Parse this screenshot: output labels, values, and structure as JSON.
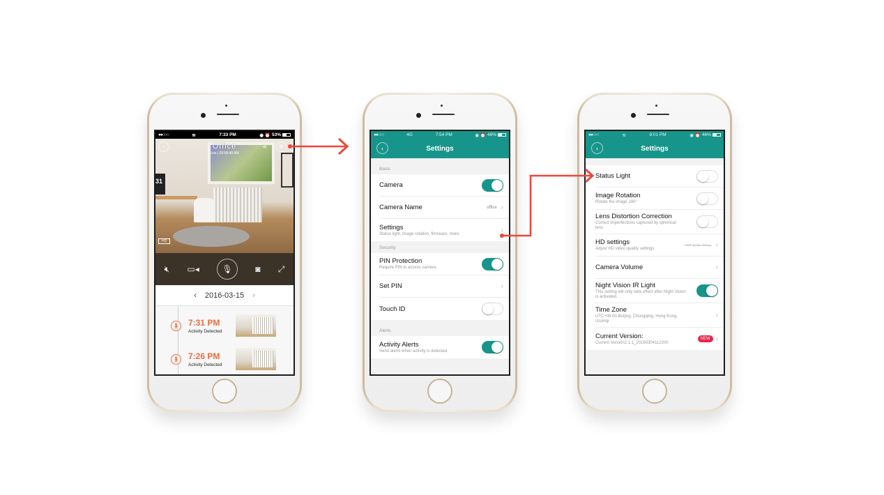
{
  "colors": {
    "teal": "#17958a",
    "accent_orange": "#f26a3d",
    "arrow_red": "#f0453a",
    "new_badge": "#e8254b"
  },
  "phone1": {
    "status": {
      "signal": "●●○○○",
      "wifi_icon": "wifi-icon",
      "time": "7:33 PM",
      "battery": "53%"
    },
    "camera": {
      "title": "Office",
      "subtitle": "Live | 02:58:40 AM",
      "quality_badge": "HD",
      "calendar_digit": "31"
    },
    "controls": [
      "mute-icon",
      "record-video-icon",
      "microphone-icon",
      "snapshot-icon",
      "fullscreen-icon"
    ],
    "date_nav": {
      "prev": "‹",
      "date": "2016-03-15",
      "next": "›"
    },
    "events": [
      {
        "time": "7:31 PM",
        "label": "Activity Detected"
      },
      {
        "time": "7:26 PM",
        "label": "Activity Detected"
      }
    ]
  },
  "phone2": {
    "status": {
      "signal": "●●○○○",
      "network": "4G",
      "time": "7:54 PM",
      "battery": "48%"
    },
    "title": "Settings",
    "sections": {
      "basic": "Basic",
      "security": "Security",
      "alerts": "Alerts"
    },
    "rows": {
      "camera": {
        "title": "Camera",
        "toggle_on": true
      },
      "camera_name": {
        "title": "Camera Name",
        "value": "office"
      },
      "settings": {
        "title": "Settings",
        "subtitle": "Status light, image rotation, firmware, more."
      },
      "pin_protection": {
        "title": "PIN Protection",
        "subtitle": "Require PIN to access camera",
        "toggle_on": true
      },
      "set_pin": {
        "title": "Set PIN"
      },
      "touch_id": {
        "title": "Touch ID",
        "toggle_on": false
      },
      "activity_alerts": {
        "title": "Activity Alerts",
        "subtitle": "Send alerts when activity is detected",
        "toggle_on": true
      }
    }
  },
  "phone3": {
    "status": {
      "signal": "●●○○○",
      "time": "8:01 PM",
      "battery": "46%"
    },
    "title": "Settings",
    "rows": {
      "status_light": {
        "title": "Status Light",
        "toggle_on": false
      },
      "image_rotation": {
        "title": "Image Rotation",
        "subtitle": "Rotate the image 180°",
        "toggle_on": false
      },
      "lens_distortion": {
        "title": "Lens Distortion Correction",
        "subtitle": "Correct imperfections captured by spherical lens",
        "toggle_on": false
      },
      "hd_settings": {
        "title": "HD settings",
        "subtitle": "Adjust HD video quality settings",
        "value": "1080P @20fps 800Kbps"
      },
      "camera_volume": {
        "title": "Camera Volume"
      },
      "night_vision": {
        "title": "Night Vision IR Light",
        "subtitle": "This setting will only take effect after Night Vision is activated.",
        "toggle_on": true
      },
      "time_zone": {
        "title": "Time Zone",
        "subtitle": "UTC+08:00,Beijing, Chongqing, Hong Kong, Urumqi"
      },
      "current_version": {
        "title": "Current Version:",
        "subtitle": "Current Version2.1.1_20160304112200",
        "badge": "NEW"
      }
    }
  }
}
